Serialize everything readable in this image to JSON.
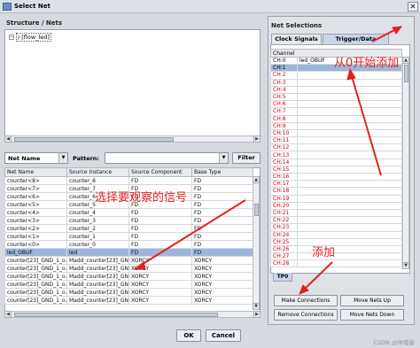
{
  "window": {
    "title": "Select Net",
    "close_glyph": "✕"
  },
  "structure": {
    "title": "Structure / Nets",
    "tree_item": "/ [flow_led]",
    "expander": "−"
  },
  "filter": {
    "column_select": "Net Name",
    "pattern_label": "Pattern:",
    "pattern_value": "",
    "filter_button": "Filter"
  },
  "net_table": {
    "columns": [
      "Net Name",
      "Source Instance",
      "Source Component",
      "Base Type"
    ],
    "rows": [
      [
        "counter<8>",
        "counter_8",
        "FD",
        "FD"
      ],
      [
        "counter<7>",
        "counter_7",
        "FD",
        "FD"
      ],
      [
        "counter<6>",
        "counter_6",
        "FD",
        "FD"
      ],
      [
        "counter<5>",
        "counter_5",
        "FD",
        "FD"
      ],
      [
        "counter<4>",
        "counter_4",
        "FD",
        "FD"
      ],
      [
        "counter<3>",
        "counter_3",
        "FD",
        "FD"
      ],
      [
        "counter<2>",
        "counter_2",
        "FD",
        "FD"
      ],
      [
        "counter<1>",
        "counter_1",
        "FD",
        "FD"
      ],
      [
        "counter<0>",
        "counter_0",
        "FD",
        "FD"
      ],
      [
        "led_OBUF",
        "led",
        "FD",
        "FD"
      ],
      [
        "counter[23]_GND_1_o...",
        "Madd_counter[23]_GN...",
        "XORCY",
        "XORCY"
      ],
      [
        "counter[23]_GND_1_o...",
        "Madd_counter[23]_GN...",
        "XORCY",
        "XORCY"
      ],
      [
        "counter[23]_GND_1_o...",
        "Madd_counter[23]_GN...",
        "XORCY",
        "XORCY"
      ],
      [
        "counter[23]_GND_1_o...",
        "Madd_counter[23]_GN...",
        "XORCY",
        "XORCY"
      ],
      [
        "counter[23]_GND_1_o...",
        "Madd_counter[23]_GN...",
        "XORCY",
        "XORCY"
      ],
      [
        "counter[23]_GND_1_o...",
        "Madd_counter[23]_GN...",
        "XORCY",
        "XORCY"
      ]
    ],
    "selected_row": 9
  },
  "net_selections": {
    "title": "Net Selections",
    "tabs": [
      "Clock Signals",
      "Trigger/Data Signals"
    ],
    "active_tab": 1,
    "channel_header": "Channel",
    "channels": [
      [
        "CH:0",
        "led_OBUF"
      ],
      [
        "CH:1",
        ""
      ],
      [
        "CH:2",
        ""
      ],
      [
        "CH:3",
        ""
      ],
      [
        "CH:4",
        ""
      ],
      [
        "CH:5",
        ""
      ],
      [
        "CH:6",
        ""
      ],
      [
        "CH:7",
        ""
      ],
      [
        "CH:8",
        ""
      ],
      [
        "CH:9",
        ""
      ],
      [
        "CH:10",
        ""
      ],
      [
        "CH:11",
        ""
      ],
      [
        "CH:12",
        ""
      ],
      [
        "CH:13",
        ""
      ],
      [
        "CH:14",
        ""
      ],
      [
        "CH:15",
        ""
      ],
      [
        "CH:16",
        ""
      ],
      [
        "CH:17",
        ""
      ],
      [
        "CH:18",
        ""
      ],
      [
        "CH:19",
        ""
      ],
      [
        "CH:20",
        ""
      ],
      [
        "CH:21",
        ""
      ],
      [
        "CH:22",
        ""
      ],
      [
        "CH:23",
        ""
      ],
      [
        "CH:24",
        ""
      ],
      [
        "CH:25",
        ""
      ],
      [
        "CH:26",
        ""
      ],
      [
        "CH:27",
        ""
      ],
      [
        "CH:28",
        ""
      ]
    ],
    "selected_channel": 1,
    "bottom_tab": "TP0"
  },
  "actions": {
    "make_connections": "Make Connections",
    "remove_connections": "Remove Connections",
    "move_up": "Move Nets Up",
    "move_down": "Move Nets Down"
  },
  "dialog": {
    "ok": "OK",
    "cancel": "Cancel"
  },
  "annotations": {
    "start_from_zero": "从0开始添加",
    "select_signal": "选择要观察的信号",
    "add": "添加",
    "color": "#e2231a"
  },
  "watermark": "CSDN @仲南音"
}
